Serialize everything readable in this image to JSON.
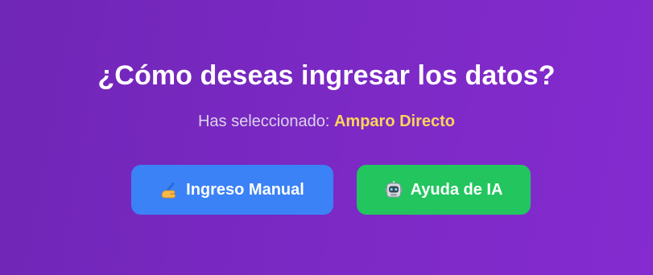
{
  "heading": "¿Cómo deseas ingresar los datos?",
  "selection": {
    "prefix": "Has seleccionado:",
    "value": "Amparo Directo"
  },
  "buttons": {
    "manual": {
      "label": "Ingreso Manual",
      "icon": "writing-hand-icon"
    },
    "ai": {
      "label": "Ayuda de IA",
      "icon": "robot-icon"
    }
  },
  "colors": {
    "background_start": "#7026b6",
    "background_end": "#852bd0",
    "manual_button": "#3b82f6",
    "ai_button": "#22c55e",
    "selection_highlight": "#fcd45a"
  }
}
